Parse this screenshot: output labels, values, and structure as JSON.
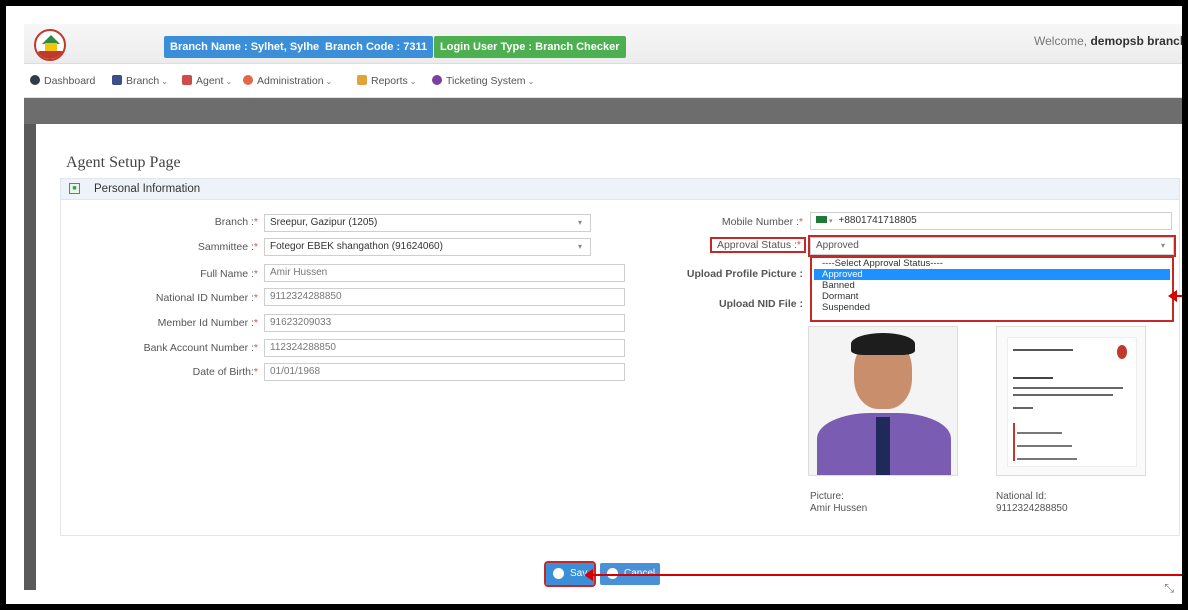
{
  "header": {
    "branch_name": "Branch Name : Sylhet, Sylhet",
    "branch_code": "Branch Code : 7311",
    "user_type": "Login User Type : Branch Checker",
    "welcome_prefix": "Welcome, ",
    "welcome_user": "demopsb branchchecke"
  },
  "nav": [
    {
      "label": "Dashboard"
    },
    {
      "label": "Branch"
    },
    {
      "label": "Agent"
    },
    {
      "label": "Administration"
    },
    {
      "label": "Reports"
    },
    {
      "label": "Ticketing System"
    }
  ],
  "page": {
    "title": "Agent Setup Page",
    "section": "Personal Information"
  },
  "form_left": {
    "branch_label": "Branch :",
    "branch_value": "Sreepur, Gazipur (1205)",
    "sammittee_label": "Sammittee :",
    "sammittee_value": "Fotegor EBEK shangathon (91624060)",
    "fullname_label": "Full Name :",
    "fullname_value": "Amir  Hussen",
    "nid_label": "National ID Number :",
    "nid_value": "9112324288850",
    "member_label": "Member Id Number :",
    "member_value": "91623209033",
    "bank_label": "Bank Account Number :",
    "bank_value": "112324288850",
    "dob_label": "Date of Birth:",
    "dob_value": "01/01/1968"
  },
  "form_right": {
    "mobile_label": "Mobile Number :",
    "mobile_value": "+8801741718805",
    "approval_label": "Approval Status :",
    "approval_value": "Approved",
    "profile_label": "Upload Profile Picture :",
    "nid_file_label": "Upload NID File :"
  },
  "approval_options": [
    "----Select Approval Status----",
    "Approved",
    "Banned",
    "Dormant",
    "Suspended"
  ],
  "captions": {
    "picture_label": "Picture:",
    "picture_name": "Amir Hussen",
    "nid_label": "National Id:",
    "nid_value": "9112324288850"
  },
  "buttons": {
    "save": "Sav",
    "cancel": "Cancel"
  },
  "colors": {
    "accent": "#3b8ed8",
    "success": "#4caf50",
    "highlight": "#c62828"
  }
}
